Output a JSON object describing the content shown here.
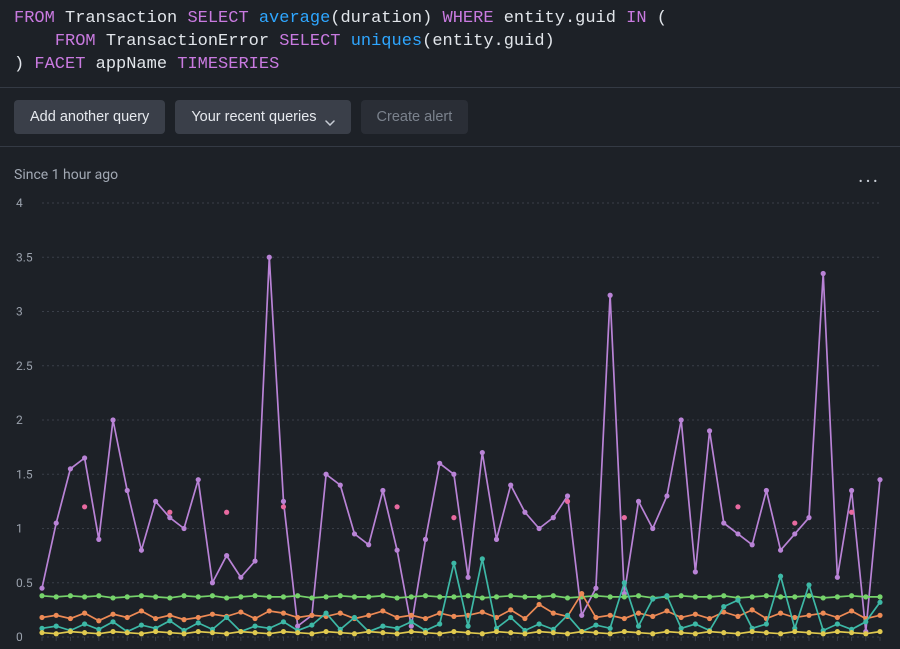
{
  "query": {
    "tokens": [
      [
        [
          "kw",
          "FROM"
        ],
        [
          "sp",
          " "
        ],
        [
          "ident",
          "Transaction"
        ],
        [
          "sp",
          " "
        ],
        [
          "kw",
          "SELECT"
        ],
        [
          "sp",
          " "
        ],
        [
          "fn",
          "average"
        ],
        [
          "punct",
          "("
        ],
        [
          "ident",
          "duration"
        ],
        [
          "punct",
          ")"
        ],
        [
          "sp",
          " "
        ],
        [
          "kw",
          "WHERE"
        ],
        [
          "sp",
          " "
        ],
        [
          "ident",
          "entity.guid"
        ],
        [
          "sp",
          " "
        ],
        [
          "kw",
          "IN"
        ],
        [
          "sp",
          " "
        ],
        [
          "punct",
          "("
        ]
      ],
      [
        [
          "sp",
          "    "
        ],
        [
          "kw",
          "FROM"
        ],
        [
          "sp",
          " "
        ],
        [
          "ident",
          "TransactionError"
        ],
        [
          "sp",
          " "
        ],
        [
          "kw",
          "SELECT"
        ],
        [
          "sp",
          " "
        ],
        [
          "fn",
          "uniques"
        ],
        [
          "punct",
          "("
        ],
        [
          "ident",
          "entity.guid"
        ],
        [
          "punct",
          ")"
        ]
      ],
      [
        [
          "punct",
          ")"
        ],
        [
          "sp",
          " "
        ],
        [
          "kw",
          "FACET"
        ],
        [
          "sp",
          " "
        ],
        [
          "ident",
          "appName"
        ],
        [
          "sp",
          " "
        ],
        [
          "kw",
          "TIMESERIES"
        ]
      ]
    ]
  },
  "toolbar": {
    "add_query_label": "Add another query",
    "recent_queries_label": "Your recent queries",
    "create_alert_label": "Create alert"
  },
  "chart": {
    "time_label": "Since 1 hour ago",
    "more_glyph": "..."
  },
  "chart_data": {
    "type": "line",
    "xlabel": "",
    "ylabel": "",
    "ylim": [
      0,
      4
    ],
    "yticks": [
      0,
      0.5,
      1,
      1.5,
      2,
      2.5,
      3,
      3.5,
      4
    ],
    "x_count": 60,
    "series": [
      {
        "name": "purple",
        "color": "#b983d6",
        "connected": true,
        "show_points": true,
        "values": [
          0.45,
          1.05,
          1.55,
          1.65,
          0.9,
          2.0,
          1.35,
          0.8,
          1.25,
          1.1,
          1.0,
          1.45,
          0.5,
          0.75,
          0.55,
          0.7,
          3.5,
          1.25,
          0.1,
          0.2,
          1.5,
          1.4,
          0.95,
          0.85,
          1.35,
          0.8,
          0.1,
          0.9,
          1.6,
          1.5,
          0.55,
          1.7,
          0.9,
          1.4,
          1.15,
          1.0,
          1.1,
          1.3,
          0.2,
          0.45,
          3.15,
          0.4,
          1.25,
          1.0,
          1.3,
          2.0,
          0.6,
          1.9,
          1.05,
          0.95,
          0.85,
          1.35,
          0.8,
          0.95,
          1.1,
          3.35,
          0.55,
          1.35,
          0.05,
          1.45
        ]
      },
      {
        "name": "pink-scatter",
        "color": "#e86aa0",
        "connected": false,
        "show_points": true,
        "values": [
          null,
          null,
          null,
          1.2,
          null,
          null,
          null,
          null,
          null,
          1.15,
          null,
          null,
          null,
          1.15,
          null,
          null,
          null,
          1.2,
          null,
          null,
          null,
          null,
          null,
          null,
          null,
          1.2,
          null,
          null,
          null,
          1.1,
          null,
          null,
          null,
          null,
          null,
          null,
          null,
          1.25,
          null,
          null,
          null,
          1.1,
          null,
          null,
          null,
          null,
          null,
          null,
          null,
          1.2,
          null,
          null,
          null,
          1.05,
          null,
          null,
          null,
          1.15,
          null,
          null
        ]
      },
      {
        "name": "green",
        "color": "#76d36b",
        "connected": true,
        "show_points": true,
        "values": [
          0.38,
          0.37,
          0.38,
          0.37,
          0.38,
          0.36,
          0.37,
          0.38,
          0.37,
          0.36,
          0.38,
          0.37,
          0.38,
          0.36,
          0.37,
          0.38,
          0.37,
          0.37,
          0.38,
          0.36,
          0.37,
          0.38,
          0.37,
          0.37,
          0.38,
          0.36,
          0.37,
          0.38,
          0.37,
          0.37,
          0.38,
          0.36,
          0.37,
          0.38,
          0.37,
          0.37,
          0.38,
          0.36,
          0.37,
          0.38,
          0.37,
          0.37,
          0.38,
          0.36,
          0.37,
          0.38,
          0.37,
          0.37,
          0.38,
          0.36,
          0.37,
          0.38,
          0.37,
          0.37,
          0.38,
          0.36,
          0.37,
          0.38,
          0.37,
          0.37
        ]
      },
      {
        "name": "orange",
        "color": "#ed8a55",
        "connected": true,
        "show_points": true,
        "values": [
          0.18,
          0.2,
          0.17,
          0.22,
          0.15,
          0.21,
          0.18,
          0.24,
          0.17,
          0.2,
          0.16,
          0.18,
          0.21,
          0.19,
          0.23,
          0.17,
          0.24,
          0.22,
          0.18,
          0.2,
          0.19,
          0.22,
          0.17,
          0.2,
          0.24,
          0.18,
          0.2,
          0.17,
          0.22,
          0.19,
          0.2,
          0.23,
          0.18,
          0.25,
          0.17,
          0.3,
          0.22,
          0.19,
          0.4,
          0.18,
          0.2,
          0.17,
          0.22,
          0.19,
          0.24,
          0.18,
          0.21,
          0.17,
          0.23,
          0.19,
          0.25,
          0.17,
          0.22,
          0.18,
          0.2,
          0.22,
          0.18,
          0.24,
          0.17,
          0.2
        ]
      },
      {
        "name": "teal",
        "color": "#3db8a6",
        "connected": true,
        "show_points": true,
        "values": [
          0.08,
          0.1,
          0.06,
          0.12,
          0.07,
          0.14,
          0.05,
          0.11,
          0.08,
          0.15,
          0.06,
          0.13,
          0.07,
          0.18,
          0.05,
          0.1,
          0.08,
          0.14,
          0.06,
          0.11,
          0.22,
          0.07,
          0.18,
          0.05,
          0.1,
          0.08,
          0.14,
          0.06,
          0.12,
          0.68,
          0.1,
          0.72,
          0.08,
          0.18,
          0.06,
          0.12,
          0.07,
          0.2,
          0.05,
          0.11,
          0.08,
          0.5,
          0.1,
          0.35,
          0.38,
          0.08,
          0.12,
          0.06,
          0.28,
          0.34,
          0.08,
          0.12,
          0.56,
          0.08,
          0.48,
          0.06,
          0.12,
          0.07,
          0.14,
          0.32
        ]
      },
      {
        "name": "yellow",
        "color": "#e0c94f",
        "connected": true,
        "show_points": true,
        "values": [
          0.04,
          0.03,
          0.05,
          0.04,
          0.03,
          0.05,
          0.04,
          0.03,
          0.05,
          0.04,
          0.03,
          0.05,
          0.04,
          0.03,
          0.05,
          0.04,
          0.03,
          0.05,
          0.04,
          0.03,
          0.05,
          0.04,
          0.03,
          0.05,
          0.04,
          0.03,
          0.05,
          0.04,
          0.03,
          0.05,
          0.04,
          0.03,
          0.05,
          0.04,
          0.03,
          0.05,
          0.04,
          0.03,
          0.05,
          0.04,
          0.03,
          0.05,
          0.04,
          0.03,
          0.05,
          0.04,
          0.03,
          0.05,
          0.04,
          0.03,
          0.05,
          0.04,
          0.03,
          0.05,
          0.04,
          0.03,
          0.05,
          0.04,
          0.03,
          0.05
        ]
      }
    ]
  }
}
